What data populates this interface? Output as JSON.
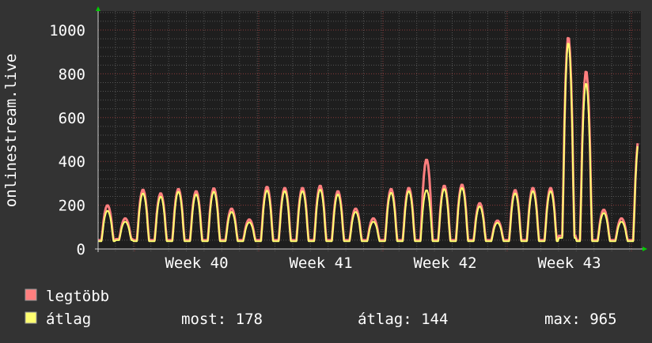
{
  "chart_data": {
    "type": "line",
    "ylabel": "onlinestream.live",
    "ylim": [
      0,
      1000
    ],
    "yticks": [
      0,
      200,
      400,
      600,
      800,
      1000
    ],
    "yticks_labels": [
      "0",
      "200",
      "400",
      "600",
      "800",
      "1000"
    ],
    "xticks_labels": [
      "Week 40",
      "Week 41",
      "Week 42",
      "Week 43"
    ],
    "grid": true,
    "x_unit": "day",
    "days": 31,
    "series": [
      {
        "name": "legtöbb",
        "color": "#ff7f7f",
        "daily_min": [
          40,
          45,
          40,
          40,
          40,
          40,
          40,
          40,
          40,
          40,
          40,
          40,
          40,
          40,
          40,
          40,
          40,
          40,
          40,
          40,
          40,
          40,
          40,
          40,
          40,
          40,
          60,
          40,
          40,
          40,
          40
        ],
        "daily_peak": [
          200,
          140,
          272,
          255,
          275,
          265,
          278,
          185,
          135,
          285,
          280,
          280,
          290,
          265,
          185,
          140,
          275,
          280,
          410,
          290,
          295,
          210,
          130,
          270,
          280,
          280,
          970,
          815,
          180,
          140,
          520
        ]
      },
      {
        "name": "átlag",
        "color": "#ffff70",
        "daily_min": [
          35,
          40,
          35,
          35,
          35,
          35,
          35,
          35,
          35,
          35,
          35,
          35,
          35,
          35,
          35,
          35,
          35,
          35,
          35,
          35,
          35,
          35,
          35,
          35,
          35,
          35,
          50,
          35,
          35,
          35,
          35
        ],
        "daily_peak": [
          175,
          125,
          255,
          240,
          262,
          250,
          262,
          170,
          122,
          268,
          265,
          265,
          272,
          250,
          170,
          125,
          258,
          265,
          270,
          275,
          280,
          195,
          120,
          255,
          265,
          265,
          945,
          760,
          165,
          125,
          505
        ]
      }
    ],
    "legend_placement": "bottom-left"
  },
  "legend": {
    "items": [
      {
        "label": "legtöbb",
        "color": "#ff7f7f"
      },
      {
        "label": "átlag",
        "color": "#ffff70"
      }
    ],
    "stats": {
      "current": "most: 178",
      "average": "átlag: 144",
      "maximum": "max: 965"
    }
  }
}
